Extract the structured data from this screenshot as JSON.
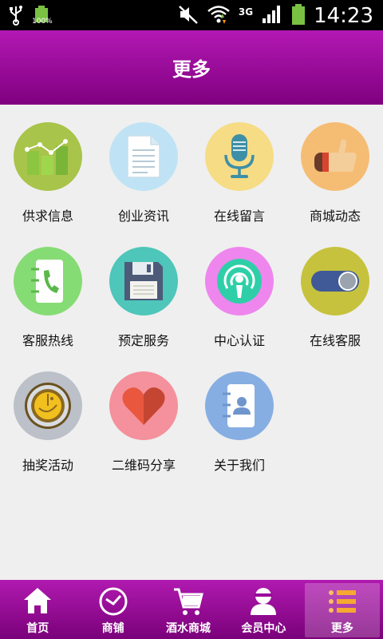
{
  "status_bar": {
    "battery_pct": "100%",
    "network": "3G",
    "time": "14:23"
  },
  "header": {
    "title": "更多"
  },
  "grid_items": [
    {
      "label": "供求信息",
      "icon": "bar-chart-icon",
      "color": "#a8c44a"
    },
    {
      "label": "创业资讯",
      "icon": "document-icon",
      "color": "#a8d8f0"
    },
    {
      "label": "在线留言",
      "icon": "microphone-icon",
      "color": "#f5d36a"
    },
    {
      "label": "商城动态",
      "icon": "thumbs-up-icon",
      "color": "#f4b060"
    },
    {
      "label": "客服热线",
      "icon": "phone-book-icon",
      "color": "#7ed86a"
    },
    {
      "label": "预定服务",
      "icon": "floppy-disk-icon",
      "color": "#4ec4b8"
    },
    {
      "label": "中心认证",
      "icon": "podcast-icon",
      "color": "#ee80ee"
    },
    {
      "label": "在线客服",
      "icon": "toggle-switch-icon",
      "color": "#c4c03c"
    },
    {
      "label": "抽奖活动",
      "icon": "lottery-wheel-icon",
      "color": "#b8bcc4"
    },
    {
      "label": "二维码分享",
      "icon": "heart-icon",
      "color": "#f48c98"
    },
    {
      "label": "关于我们",
      "icon": "contacts-book-icon",
      "color": "#7ea8e0"
    }
  ],
  "tabs": [
    {
      "label": "首页",
      "icon": "home-icon",
      "active": false
    },
    {
      "label": "商铺",
      "icon": "clock-icon",
      "active": false
    },
    {
      "label": "酒水商城",
      "icon": "cart-icon",
      "active": false
    },
    {
      "label": "会员中心",
      "icon": "user-icon",
      "active": false
    },
    {
      "label": "更多",
      "icon": "list-icon",
      "active": true
    }
  ]
}
